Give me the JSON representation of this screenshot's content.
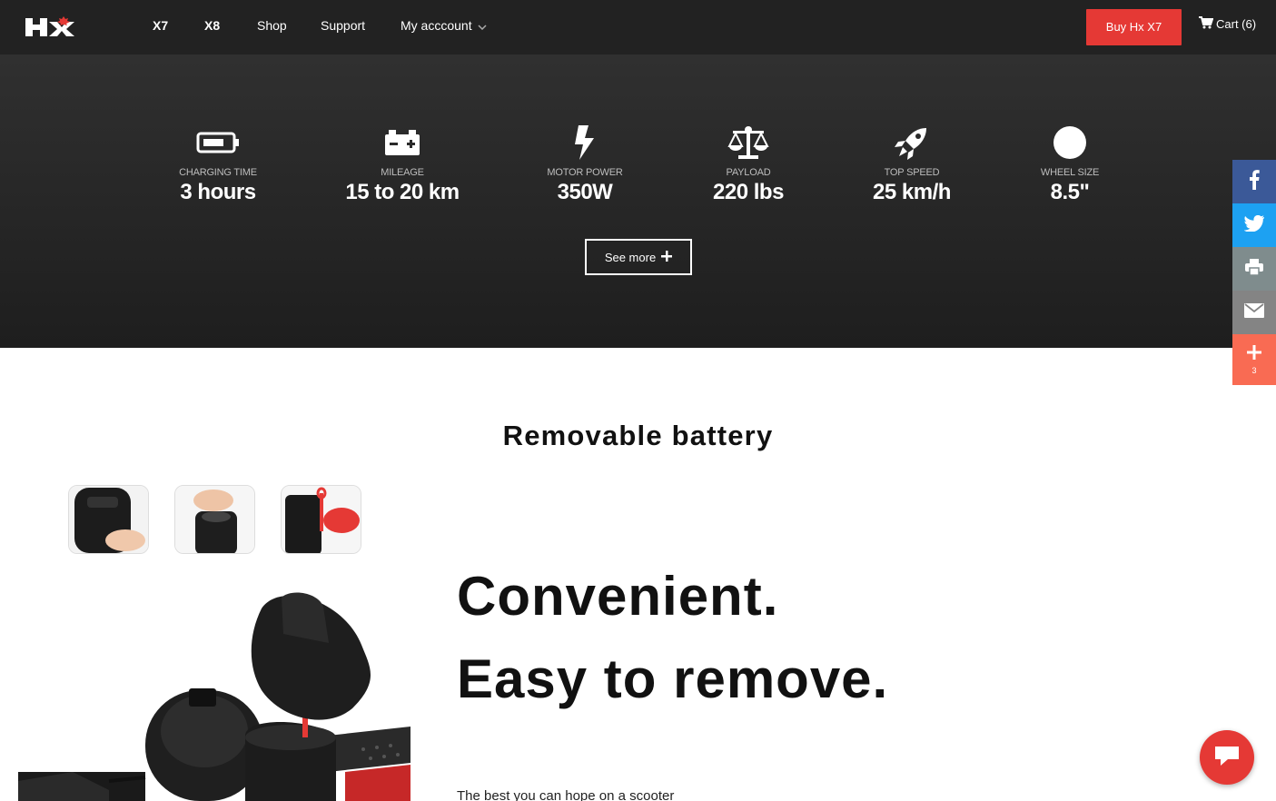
{
  "nav": {
    "brand": "Hx",
    "links": [
      "X7",
      "X8",
      "Shop",
      "Support",
      "My acccount"
    ],
    "buy_label": "Buy Hx X7",
    "cart_label": "Cart (6)"
  },
  "specs": [
    {
      "icon": "battery-icon",
      "label": "CHARGING TIME",
      "value": "3 hours"
    },
    {
      "icon": "car-battery-icon",
      "label": "MILEAGE",
      "value": "15 to 20 km"
    },
    {
      "icon": "bolt-icon",
      "label": "MOTOR POWER",
      "value": "350W"
    },
    {
      "icon": "balance-scale-icon",
      "label": "PAYLOAD",
      "value": "220 lbs"
    },
    {
      "icon": "rocket-icon",
      "label": "TOP SPEED",
      "value": "25 km/h"
    },
    {
      "icon": "circle-icon",
      "label": "WHEEL SIZE",
      "value": "8.5\""
    }
  ],
  "see_more_label": "See more",
  "share": {
    "colors": {
      "facebook": "#3b5998",
      "twitter": "#1da1f2",
      "print": "#7f8c8d",
      "email": "#848484",
      "more": "#f96b53"
    },
    "more_count": "3"
  },
  "content": {
    "section_title": "Removable battery",
    "headline_1": "Convenient.",
    "headline_2": "Easy to remove.",
    "subtext": "The best you can hope on a scooter"
  },
  "colors": {
    "accent": "#e53935",
    "nav_bg": "#222222"
  }
}
